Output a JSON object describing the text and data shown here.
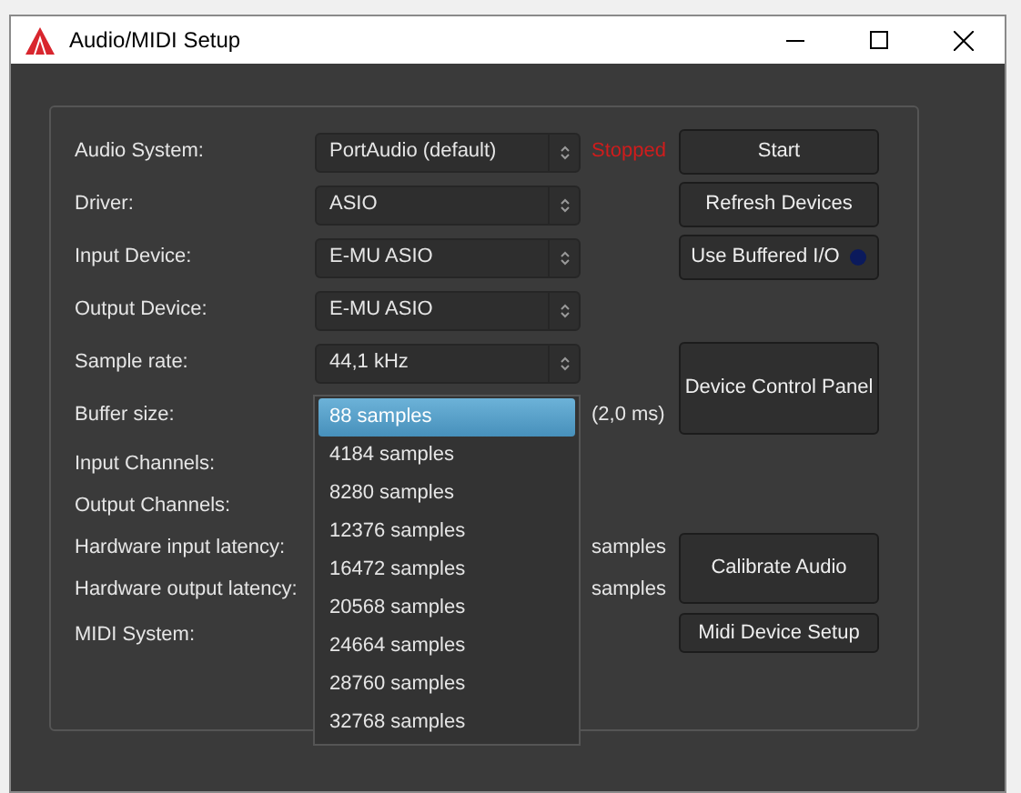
{
  "window": {
    "title": "Audio/MIDI Setup"
  },
  "settings": [
    {
      "label": "Audio System:",
      "value": "PortAudio (default)",
      "status": "Stopped"
    },
    {
      "label": "Driver:",
      "value": "ASIO"
    },
    {
      "label": "Input Device:",
      "value": "E-MU ASIO"
    },
    {
      "label": "Output Device:",
      "value": "E-MU ASIO"
    },
    {
      "label": "Sample rate:",
      "value": "44,1 kHz"
    },
    {
      "label": "Buffer size:",
      "unit": "(2,0 ms)"
    },
    {
      "label": "Input Channels:"
    },
    {
      "label": "Output Channels:"
    },
    {
      "label": "Hardware input latency:",
      "unit": "samples"
    },
    {
      "label": "Hardware output latency:",
      "unit": "samples"
    },
    {
      "label": "MIDI System:"
    }
  ],
  "buttons": [
    {
      "label": "Start",
      "kind": "push"
    },
    {
      "label": "Refresh Devices",
      "kind": "push"
    },
    {
      "label": "Use Buffered I/O",
      "kind": "toggle",
      "on": false
    },
    {
      "label": "Device Control Panel",
      "kind": "push"
    },
    {
      "label": "Calibrate Audio",
      "kind": "push"
    },
    {
      "label": "Midi Device Setup",
      "kind": "push"
    }
  ],
  "buffer_size_dropdown": [
    {
      "label": "88 samples",
      "selected": true
    },
    {
      "label": "4184 samples",
      "selected": false
    },
    {
      "label": "8280 samples",
      "selected": false
    },
    {
      "label": "12376 samples",
      "selected": false
    },
    {
      "label": "16472 samples",
      "selected": false
    },
    {
      "label": "20568 samples",
      "selected": false
    },
    {
      "label": "24664 samples",
      "selected": false
    },
    {
      "label": "28760 samples",
      "selected": false
    },
    {
      "label": "32768 samples",
      "selected": false
    }
  ]
}
